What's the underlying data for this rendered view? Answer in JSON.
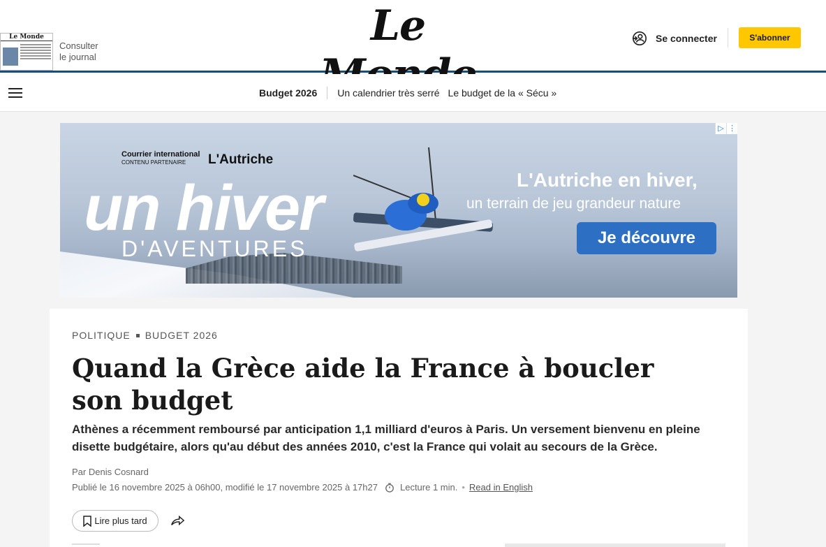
{
  "header": {
    "paper_thumb_title": "Le Monde",
    "consult_line1": "Consulter",
    "consult_line2": "le journal",
    "logo": "Le Monde",
    "login_label": "Se connecter",
    "subscribe_label": "S'abonner"
  },
  "nav": {
    "section": "Budget 2026",
    "links": [
      "Un calendrier très serré",
      "Le budget de la « Sécu »"
    ]
  },
  "ad": {
    "partner": "Courrier international",
    "partner_sub": "CONTENU PARTENAIRE",
    "brand": "L'Autriche",
    "big_line1": "un hiver",
    "big_line2": "D'AVENTURES",
    "headline": "L'Autriche en hiver,",
    "subline": "un terrain de jeu grandeur nature",
    "cta": "Je découvre"
  },
  "article": {
    "category": "POLITIQUE",
    "subcategory": "BUDGET 2026",
    "title": "Quand la Grèce aide la France à boucler son budget",
    "description": "Athènes a récemment remboursé par anticipation 1,1 milliard d'euros à Paris. Un versement bienvenu en pleine disette budgétaire, alors qu'au début des années 2010, c'est la France qui volait au secours de la Grèce.",
    "author": "Par Denis Cosnard",
    "published": "Publié le 16 novembre 2025 à 06h00, modifié le 17 novembre 2025 à 17h27",
    "reading_time": "Lecture 1 min.",
    "read_english": "Read in English",
    "save_label": "Lire plus tard"
  },
  "colors": {
    "accent_blue": "#1a4e7a",
    "subscribe_yellow": "#ffc700",
    "cta_blue": "#2d6fc2"
  }
}
